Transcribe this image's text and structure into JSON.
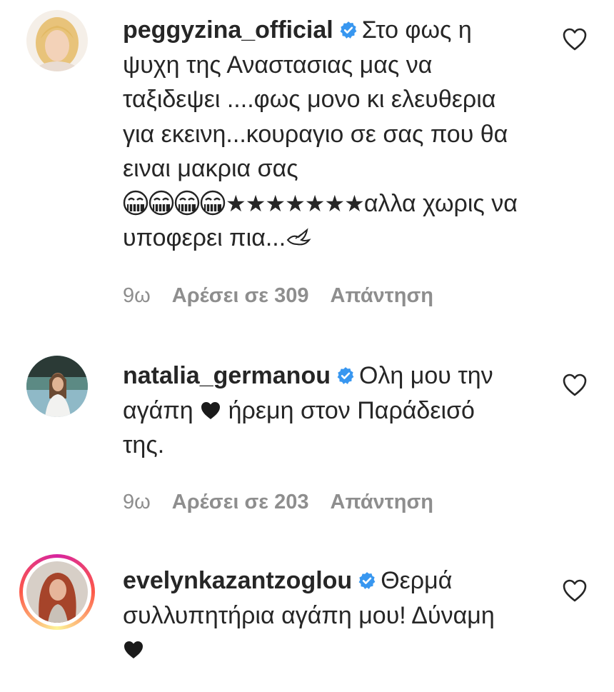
{
  "comments": [
    {
      "username": "peggyzina_official",
      "verified": true,
      "text_parts": [
        "Στο φως η ψυχη της Αναστασιας μας να ταξιδεψει ....φως μονο κι ελευθερια για εκεινη...κουραγιο σε σας που θα ειναι μακρια σας ",
        "αλλα χωρις να υποφερει πια..."
      ],
      "stars": "★★★★★★★",
      "time": "9ω",
      "likes": "Αρέσει σε 309",
      "reply": "Απάντηση"
    },
    {
      "username": "natalia_germanou",
      "verified": true,
      "text_parts": [
        "Ολη μου την αγάπη ",
        " ήρεμη στον Παράδεισό της."
      ],
      "time": "9ω",
      "likes": "Αρέσει σε 203",
      "reply": "Απάντηση"
    },
    {
      "username": "evelynkazantzoglou",
      "verified": true,
      "text_parts": [
        "Θερμά συλλυπητήρια αγάπη μου! Δύναμη "
      ]
    }
  ],
  "colors": {
    "text": "#262626",
    "meta": "#8e8e8e",
    "verified_blue": "#3897f0",
    "story_ring": "#d6249f"
  },
  "icons": {
    "like": "heart-outline-icon",
    "verified": "verified-badge-icon",
    "heart": "black-heart-icon"
  }
}
